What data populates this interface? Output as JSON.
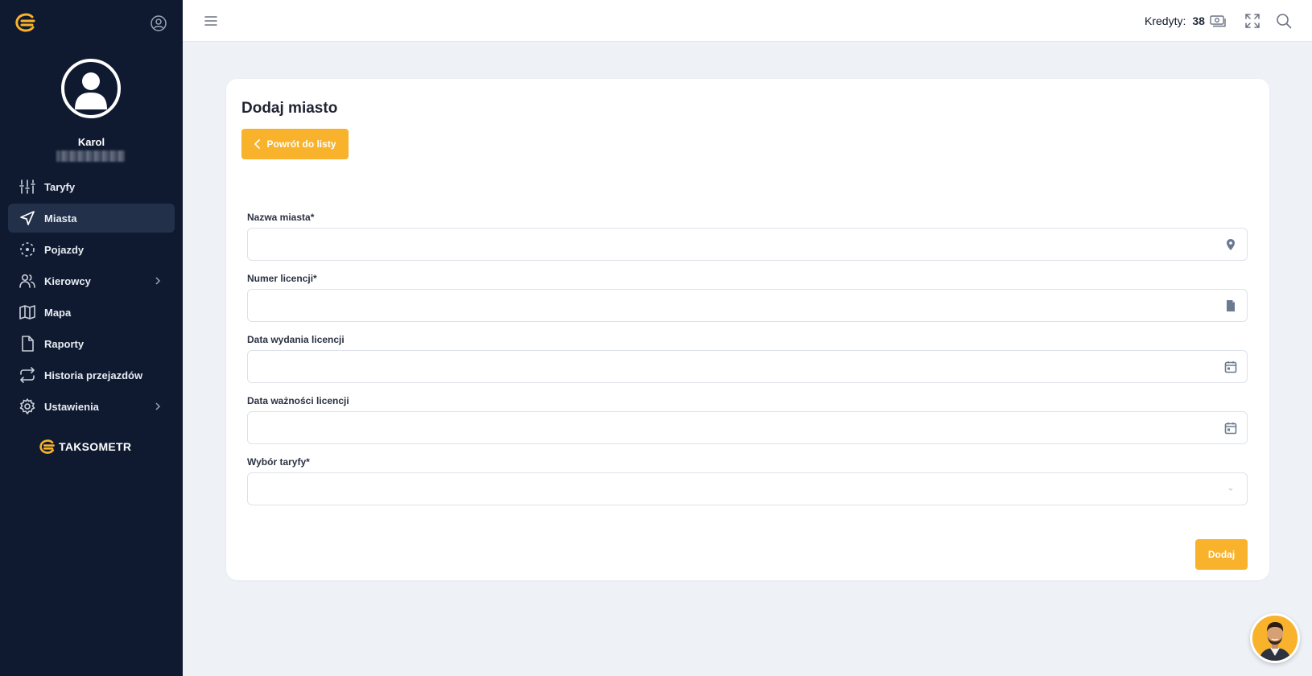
{
  "sidebar": {
    "user": {
      "name": "Karol"
    },
    "items": [
      {
        "label": "Taryfy",
        "icon": "sliders-icon"
      },
      {
        "label": "Miasta",
        "icon": "navigation-arrow-icon",
        "active": true
      },
      {
        "label": "Pojazdy",
        "icon": "dashed-circle-icon"
      },
      {
        "label": "Kierowcy",
        "icon": "users-icon",
        "has_submenu": true
      },
      {
        "label": "Mapa",
        "icon": "map-icon"
      },
      {
        "label": "Raporty",
        "icon": "file-icon"
      },
      {
        "label": "Historia przejazdów",
        "icon": "repeat-icon"
      },
      {
        "label": "Ustawienia",
        "icon": "gear-icon",
        "has_submenu": true
      }
    ],
    "brand": "TAKSOMETR"
  },
  "topbar": {
    "credits_label": "Kredyty:",
    "credits_value": "38"
  },
  "form": {
    "title": "Dodaj miasto",
    "back_label": "Powrót do listy",
    "fields": [
      {
        "label": "Nazwa miasta*",
        "value": "",
        "icon": "map-pin-icon"
      },
      {
        "label": "Numer licencji*",
        "value": "",
        "icon": "document-icon"
      },
      {
        "label": "Data wydania licencji",
        "value": "",
        "icon": "calendar-icon"
      },
      {
        "label": "Data ważności licencji",
        "value": "",
        "icon": "calendar-icon"
      },
      {
        "label": "Wybór taryfy*",
        "value": "",
        "icon": "chevron-down-icon"
      }
    ],
    "submit_label": "Dodaj"
  },
  "colors": {
    "sidebar_bg": "#0f1a30",
    "accent": "#f9b22b",
    "page_bg": "#eef2f7"
  }
}
